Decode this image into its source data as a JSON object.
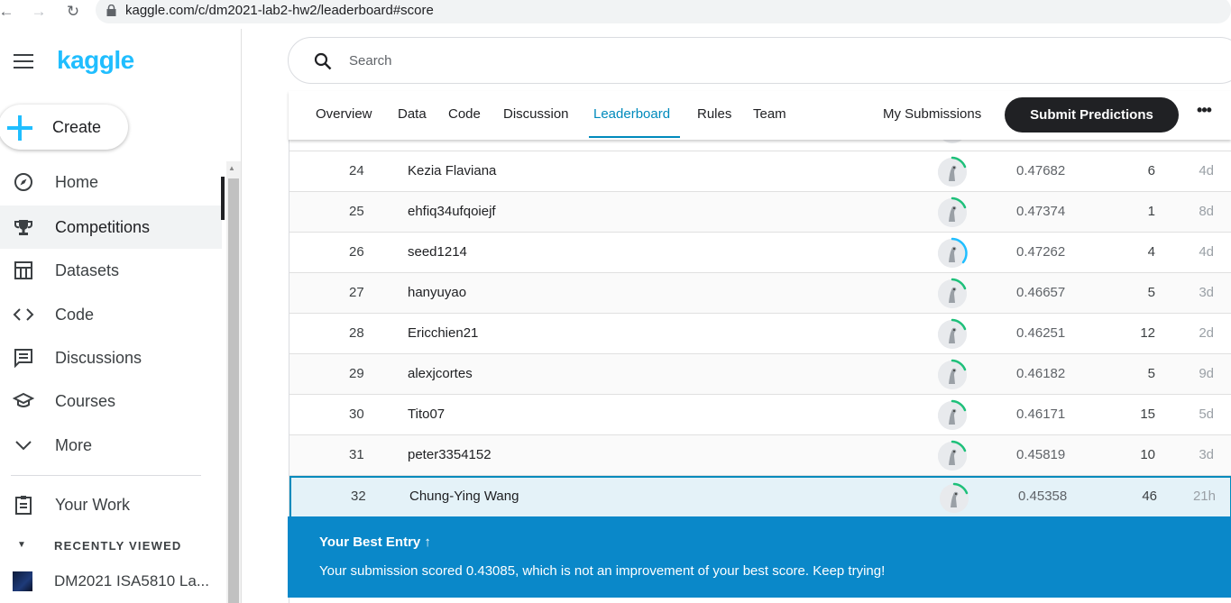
{
  "browser": {
    "url": "kaggle.com/c/dm2021-lab2-hw2/leaderboard#score"
  },
  "sidebar": {
    "logo": "kaggle",
    "create_label": "Create",
    "items": [
      {
        "label": "Home",
        "icon": "compass-icon"
      },
      {
        "label": "Competitions",
        "icon": "trophy-icon",
        "active": true
      },
      {
        "label": "Datasets",
        "icon": "table-icon"
      },
      {
        "label": "Code",
        "icon": "code-icon"
      },
      {
        "label": "Discussions",
        "icon": "comment-icon"
      },
      {
        "label": "Courses",
        "icon": "school-icon"
      },
      {
        "label": "More",
        "icon": "chevron-down-icon"
      }
    ],
    "your_work": "Your Work",
    "recently_viewed_label": "RECENTLY VIEWED",
    "recent_item": "DM2021 ISA5810 La..."
  },
  "search": {
    "placeholder": "Search"
  },
  "tabs": {
    "items": [
      "Overview",
      "Data",
      "Code",
      "Discussion",
      "Leaderboard",
      "Rules",
      "Team"
    ],
    "active": "Leaderboard",
    "my_submissions": "My Submissions",
    "submit_label": "Submit Predictions",
    "more_label": "•••"
  },
  "leaderboard": {
    "rows": [
      {
        "rank": "24",
        "name": "Kezia Flaviana",
        "score": "0.47682",
        "entries": "6",
        "last": "4d"
      },
      {
        "rank": "25",
        "name": "ehfiq34ufqoiejf",
        "score": "0.47374",
        "entries": "1",
        "last": "8d"
      },
      {
        "rank": "26",
        "name": "seed1214",
        "score": "0.47262",
        "entries": "4",
        "last": "4d"
      },
      {
        "rank": "27",
        "name": "hanyuyao",
        "score": "0.46657",
        "entries": "5",
        "last": "3d"
      },
      {
        "rank": "28",
        "name": "Ericchien21",
        "score": "0.46251",
        "entries": "12",
        "last": "2d"
      },
      {
        "rank": "29",
        "name": "alexjcortes",
        "score": "0.46182",
        "entries": "5",
        "last": "9d"
      },
      {
        "rank": "30",
        "name": "Tito07",
        "score": "0.46171",
        "entries": "15",
        "last": "5d"
      },
      {
        "rank": "31",
        "name": "peter3354152",
        "score": "0.45819",
        "entries": "10",
        "last": "3d"
      },
      {
        "rank": "32",
        "name": "Chung-Ying Wang",
        "score": "0.45358",
        "entries": "46",
        "last": "21h"
      }
    ]
  },
  "banner": {
    "title": "Your Best Entry ↑",
    "message": "Your submission scored 0.43085, which is not an improvement of your best score. Keep trying!"
  },
  "colors": {
    "brand": "#20beff",
    "accent": "#008abc",
    "banner": "#0a88c9",
    "ring_green": "#1ec07a",
    "ring_blue": "#20beff"
  }
}
